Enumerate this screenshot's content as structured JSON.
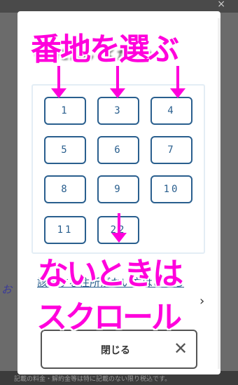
{
  "annotations": {
    "title": "番地を選ぶ",
    "none_case": "ないときは",
    "scroll": "スクロール"
  },
  "background": {
    "footer_note": "記載の料金・解約金等は特に記載のない限り税込です。",
    "top_close": "×"
  },
  "modal": {
    "heading": "番地を選んでください",
    "numbers": [
      "1",
      "3",
      "4",
      "5",
      "6",
      "7",
      "8",
      "9",
      "10",
      "11",
      "22"
    ],
    "no_address_link": "該当する住所がない方はこちら",
    "close_label": "閉じる"
  },
  "icons": {
    "close": "close-icon",
    "chevron": "chevron-right-icon"
  },
  "colors": {
    "accent": "#2a5f8e",
    "annotation": "#ff00dc"
  }
}
